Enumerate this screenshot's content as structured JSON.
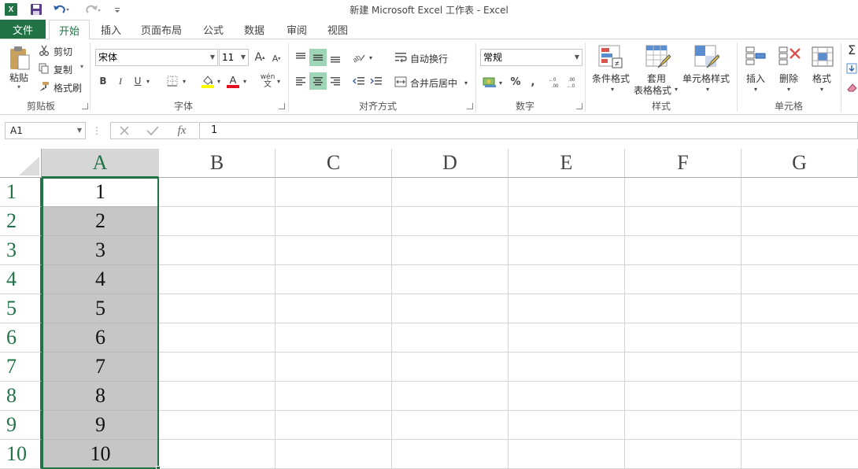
{
  "window": {
    "title": "新建 Microsoft Excel 工作表 - Excel",
    "app_icon": "X"
  },
  "tabs": [
    "文件",
    "开始",
    "插入",
    "页面布局",
    "公式",
    "数据",
    "审阅",
    "视图"
  ],
  "clipboard": {
    "paste": "粘贴",
    "cut": "剪切",
    "copy": "复制",
    "format_painter": "格式刷",
    "group": "剪贴板"
  },
  "font": {
    "name": "宋体",
    "size": "11",
    "bold": "B",
    "italic": "I",
    "underline": "U",
    "wen": "wén",
    "group": "字体"
  },
  "alignment": {
    "wrap_text": "自动换行",
    "merge_center": "合并后居中",
    "group": "对齐方式"
  },
  "number": {
    "format": "常规",
    "percent": "%",
    "comma": ",",
    "group": "数字"
  },
  "styles": {
    "conditional": "条件格式",
    "table_1": "套用",
    "table_2": "表格格式",
    "cell_styles": "单元格样式",
    "group": "样式"
  },
  "cells": {
    "insert": "插入",
    "delete": "删除",
    "format": "格式",
    "group": "单元格"
  },
  "formula_bar": {
    "name_box": "A1",
    "fx": "fx",
    "value": "1"
  },
  "sheet": {
    "columns": [
      "A",
      "B",
      "C",
      "D",
      "E",
      "F",
      "G"
    ],
    "rows": [
      "1",
      "2",
      "3",
      "4",
      "5",
      "6",
      "7",
      "8",
      "9",
      "10"
    ],
    "col_a_values": [
      "1",
      "2",
      "3",
      "4",
      "5",
      "6",
      "7",
      "8",
      "9",
      "10"
    ],
    "active_cell": "A1"
  },
  "colors": {
    "accent": "#217346",
    "selection": "#c6c6c6",
    "toggle_on": "#9fd5b7"
  }
}
